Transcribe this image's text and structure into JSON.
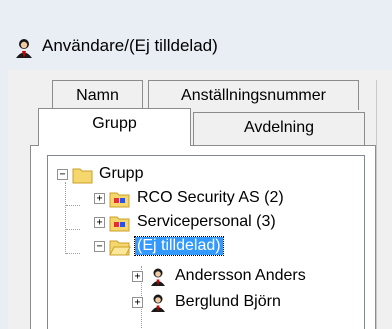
{
  "window": {
    "title": "Användare/(Ej tilldelad)",
    "icon": "user-icon"
  },
  "tabs": {
    "row1": [
      {
        "label": "Namn"
      },
      {
        "label": "Anställningsnummer"
      }
    ],
    "row2": [
      {
        "label": "Grupp",
        "selected": true
      },
      {
        "label": "Avdelning"
      }
    ]
  },
  "tree": {
    "root": {
      "label": "Grupp",
      "expander": "−",
      "icon": "folder-icon"
    },
    "groups": [
      {
        "label": "RCO Security AS (2)",
        "expander": "+",
        "icon": "group-folder-icon"
      },
      {
        "label": "Servicepersonal (3)",
        "expander": "+",
        "icon": "group-folder-icon"
      },
      {
        "label": "(Ej tilldelad)",
        "expander": "−",
        "icon": "folder-icon",
        "selected": true
      }
    ],
    "users": [
      {
        "label": "Andersson Anders",
        "expander": "+",
        "icon": "user-icon"
      },
      {
        "label": "Berglund Björn",
        "expander": "+",
        "icon": "user-icon"
      }
    ]
  },
  "colors": {
    "selection": "#3399ff",
    "folder": "#f5d76e",
    "titlebar": "#e9eef5"
  }
}
